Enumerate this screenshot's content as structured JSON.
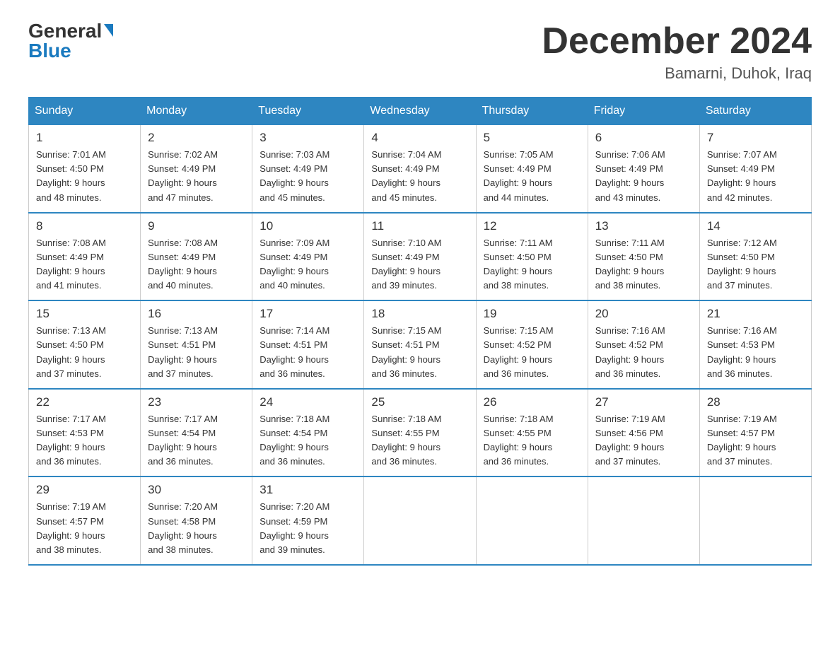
{
  "logo": {
    "general": "General",
    "blue": "Blue",
    "triangle": "▲"
  },
  "title": {
    "month_year": "December 2024",
    "location": "Bamarni, Duhok, Iraq"
  },
  "days_of_week": [
    "Sunday",
    "Monday",
    "Tuesday",
    "Wednesday",
    "Thursday",
    "Friday",
    "Saturday"
  ],
  "weeks": [
    [
      {
        "day": "1",
        "sunrise": "7:01 AM",
        "sunset": "4:50 PM",
        "daylight": "9 hours and 48 minutes."
      },
      {
        "day": "2",
        "sunrise": "7:02 AM",
        "sunset": "4:49 PM",
        "daylight": "9 hours and 47 minutes."
      },
      {
        "day": "3",
        "sunrise": "7:03 AM",
        "sunset": "4:49 PM",
        "daylight": "9 hours and 45 minutes."
      },
      {
        "day": "4",
        "sunrise": "7:04 AM",
        "sunset": "4:49 PM",
        "daylight": "9 hours and 45 minutes."
      },
      {
        "day": "5",
        "sunrise": "7:05 AM",
        "sunset": "4:49 PM",
        "daylight": "9 hours and 44 minutes."
      },
      {
        "day": "6",
        "sunrise": "7:06 AM",
        "sunset": "4:49 PM",
        "daylight": "9 hours and 43 minutes."
      },
      {
        "day": "7",
        "sunrise": "7:07 AM",
        "sunset": "4:49 PM",
        "daylight": "9 hours and 42 minutes."
      }
    ],
    [
      {
        "day": "8",
        "sunrise": "7:08 AM",
        "sunset": "4:49 PM",
        "daylight": "9 hours and 41 minutes."
      },
      {
        "day": "9",
        "sunrise": "7:08 AM",
        "sunset": "4:49 PM",
        "daylight": "9 hours and 40 minutes."
      },
      {
        "day": "10",
        "sunrise": "7:09 AM",
        "sunset": "4:49 PM",
        "daylight": "9 hours and 40 minutes."
      },
      {
        "day": "11",
        "sunrise": "7:10 AM",
        "sunset": "4:49 PM",
        "daylight": "9 hours and 39 minutes."
      },
      {
        "day": "12",
        "sunrise": "7:11 AM",
        "sunset": "4:50 PM",
        "daylight": "9 hours and 38 minutes."
      },
      {
        "day": "13",
        "sunrise": "7:11 AM",
        "sunset": "4:50 PM",
        "daylight": "9 hours and 38 minutes."
      },
      {
        "day": "14",
        "sunrise": "7:12 AM",
        "sunset": "4:50 PM",
        "daylight": "9 hours and 37 minutes."
      }
    ],
    [
      {
        "day": "15",
        "sunrise": "7:13 AM",
        "sunset": "4:50 PM",
        "daylight": "9 hours and 37 minutes."
      },
      {
        "day": "16",
        "sunrise": "7:13 AM",
        "sunset": "4:51 PM",
        "daylight": "9 hours and 37 minutes."
      },
      {
        "day": "17",
        "sunrise": "7:14 AM",
        "sunset": "4:51 PM",
        "daylight": "9 hours and 36 minutes."
      },
      {
        "day": "18",
        "sunrise": "7:15 AM",
        "sunset": "4:51 PM",
        "daylight": "9 hours and 36 minutes."
      },
      {
        "day": "19",
        "sunrise": "7:15 AM",
        "sunset": "4:52 PM",
        "daylight": "9 hours and 36 minutes."
      },
      {
        "day": "20",
        "sunrise": "7:16 AM",
        "sunset": "4:52 PM",
        "daylight": "9 hours and 36 minutes."
      },
      {
        "day": "21",
        "sunrise": "7:16 AM",
        "sunset": "4:53 PM",
        "daylight": "9 hours and 36 minutes."
      }
    ],
    [
      {
        "day": "22",
        "sunrise": "7:17 AM",
        "sunset": "4:53 PM",
        "daylight": "9 hours and 36 minutes."
      },
      {
        "day": "23",
        "sunrise": "7:17 AM",
        "sunset": "4:54 PM",
        "daylight": "9 hours and 36 minutes."
      },
      {
        "day": "24",
        "sunrise": "7:18 AM",
        "sunset": "4:54 PM",
        "daylight": "9 hours and 36 minutes."
      },
      {
        "day": "25",
        "sunrise": "7:18 AM",
        "sunset": "4:55 PM",
        "daylight": "9 hours and 36 minutes."
      },
      {
        "day": "26",
        "sunrise": "7:18 AM",
        "sunset": "4:55 PM",
        "daylight": "9 hours and 36 minutes."
      },
      {
        "day": "27",
        "sunrise": "7:19 AM",
        "sunset": "4:56 PM",
        "daylight": "9 hours and 37 minutes."
      },
      {
        "day": "28",
        "sunrise": "7:19 AM",
        "sunset": "4:57 PM",
        "daylight": "9 hours and 37 minutes."
      }
    ],
    [
      {
        "day": "29",
        "sunrise": "7:19 AM",
        "sunset": "4:57 PM",
        "daylight": "9 hours and 38 minutes."
      },
      {
        "day": "30",
        "sunrise": "7:20 AM",
        "sunset": "4:58 PM",
        "daylight": "9 hours and 38 minutes."
      },
      {
        "day": "31",
        "sunrise": "7:20 AM",
        "sunset": "4:59 PM",
        "daylight": "9 hours and 39 minutes."
      },
      null,
      null,
      null,
      null
    ]
  ],
  "labels": {
    "sunrise": "Sunrise:",
    "sunset": "Sunset:",
    "daylight": "Daylight:"
  }
}
